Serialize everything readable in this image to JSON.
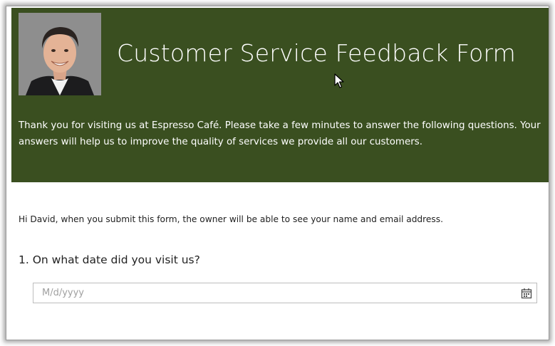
{
  "header": {
    "title": "Customer Service Feedback Form",
    "intro": "Thank you for visiting us at Espresso Café. Please take a few minutes to answer the following questions. Your answers will help us to improve the quality of services we provide all our customers.",
    "background_color": "#3a4f20",
    "avatar_icon": "person-photo"
  },
  "form": {
    "notice": "Hi David, when you submit this form, the owner will be able to see your name and email address.",
    "questions": [
      {
        "label": "1. On what date did you visit us?",
        "input": {
          "placeholder": "M/d/yyyy",
          "value": "",
          "icon": "calendar-icon"
        }
      }
    ]
  }
}
